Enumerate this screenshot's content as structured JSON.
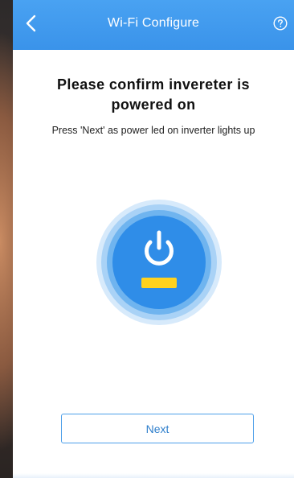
{
  "navbar": {
    "title": "Wi-Fi Configure",
    "back_icon": "chevron-left-icon",
    "help_icon": "question-circle-icon",
    "color": "#3a93ea"
  },
  "main": {
    "headline": "Please confirm invereter is powered on",
    "instruction": "Press 'Next' as power led on inverter lights up",
    "illustration_icon": "power-icon",
    "led_color": "#ffd21f",
    "next_label": "Next"
  }
}
